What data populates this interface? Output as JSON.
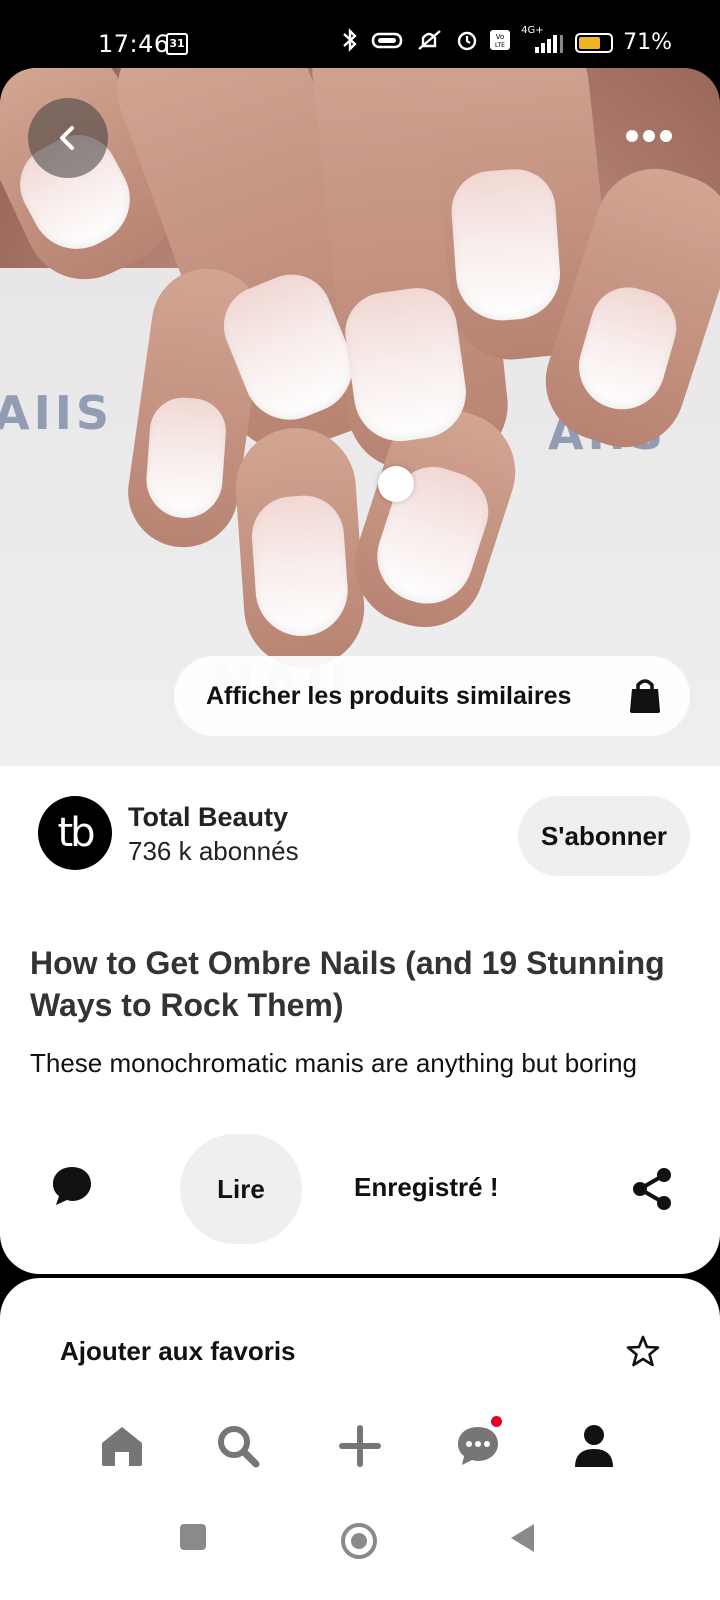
{
  "status_bar": {
    "time": "17:46",
    "calendar_day": "31",
    "network_label": "4G+",
    "battery_percent": "71%",
    "battery_level": 0.71,
    "battery_color": "#f0b323"
  },
  "hero": {
    "shop_similar_label": "Afficher les produits similaires",
    "icons": [
      "back-arrow-icon",
      "more-options-icon",
      "shopping-bag-icon"
    ]
  },
  "author": {
    "avatar_text": "tb",
    "name": "Total Beauty",
    "followers": "736 k abonnés",
    "follow_label": "S'abonner"
  },
  "pin": {
    "title": "How to Get Ombre Nails (and 19 Stunning Ways to Rock Them)",
    "description": "These monochromatic manis are anything but boring"
  },
  "actions": {
    "read_label": "Lire",
    "saved_label": "Enregistré !",
    "icons": [
      "comment-icon",
      "share-icon"
    ]
  },
  "sheet": {
    "favorite_label": "Ajouter aux favoris"
  },
  "bottom_nav": {
    "items": [
      "home-icon",
      "search-icon",
      "create-icon",
      "messages-icon",
      "profile-icon"
    ],
    "notification_color": "#e60023"
  },
  "system_nav": [
    "recents-button",
    "home-button",
    "back-button"
  ]
}
